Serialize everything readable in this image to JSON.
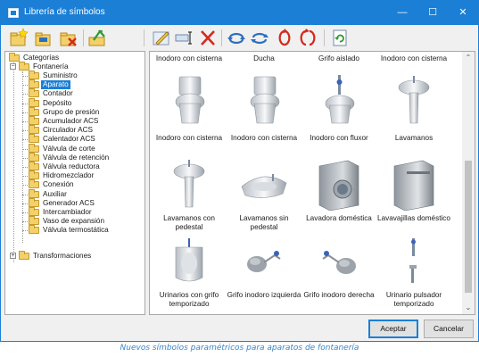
{
  "window": {
    "title": "Librería de símbolos"
  },
  "titlebar_buttons": {
    "minimize": "—",
    "maximize": "☐",
    "close": "✕"
  },
  "tree": {
    "root": "Categorías",
    "fontaneria": "Fontanería",
    "items": [
      "Suministro",
      "Aparato",
      "Contador",
      "Depósito",
      "Grupo de presión",
      "Acumulador ACS",
      "Circulador ACS",
      "Calentador ACS",
      "Válvula de corte",
      "Válvula de retención",
      "Válvula reductora",
      "Hidromezclador",
      "Conexión",
      "Auxiliar",
      "Generador ACS",
      "Intercambiador",
      "Vaso de expansión",
      "Válvula termostática"
    ],
    "selected": "Aparato",
    "transformaciones": "Transformaciones",
    "expander_open": "−",
    "expander_closed": "+"
  },
  "grid": {
    "header_row": [
      "Inodoro con cisterna",
      "Ducha",
      "Grifo aislado",
      "Inodoro con cisterna"
    ],
    "rows": [
      [
        {
          "label": "Inodoro con cisterna",
          "icon": "toilet-icon"
        },
        {
          "label": "Inodoro con cisterna",
          "icon": "toilet-icon"
        },
        {
          "label": "Inodoro con fluxor",
          "icon": "flush-valve-toilet-icon"
        },
        {
          "label": "Lavamanos",
          "icon": "pedestal-sink-icon"
        }
      ],
      [
        {
          "label": "Lavamanos con pedestal",
          "icon": "pedestal-sink-icon"
        },
        {
          "label": "Lavamanos sin pedestal",
          "icon": "wall-sink-icon"
        },
        {
          "label": "Lavadora doméstica",
          "icon": "washing-machine-icon"
        },
        {
          "label": "Lavavajillas doméstico",
          "icon": "dishwasher-icon"
        }
      ],
      [
        {
          "label": "Urinarios con grifo temporizado",
          "icon": "urinal-icon"
        },
        {
          "label": "Grifo inodoro izquierda",
          "icon": "toilet-tap-left-icon"
        },
        {
          "label": "Grifo inodoro derecha",
          "icon": "toilet-tap-right-icon"
        },
        {
          "label": "Urinario pulsador temporizado",
          "icon": "push-button-tap-icon"
        }
      ]
    ]
  },
  "scrollbar": {
    "up": "⌃",
    "down": "⌄"
  },
  "buttons": {
    "accept": "Aceptar",
    "cancel": "Cancelar"
  },
  "caption": "Nuevos símbolos paramétricos para aparatos de fontanería",
  "colors": {
    "accent": "#1b7fd6",
    "caption": "#3a86c8",
    "folder": "#f4d069"
  }
}
